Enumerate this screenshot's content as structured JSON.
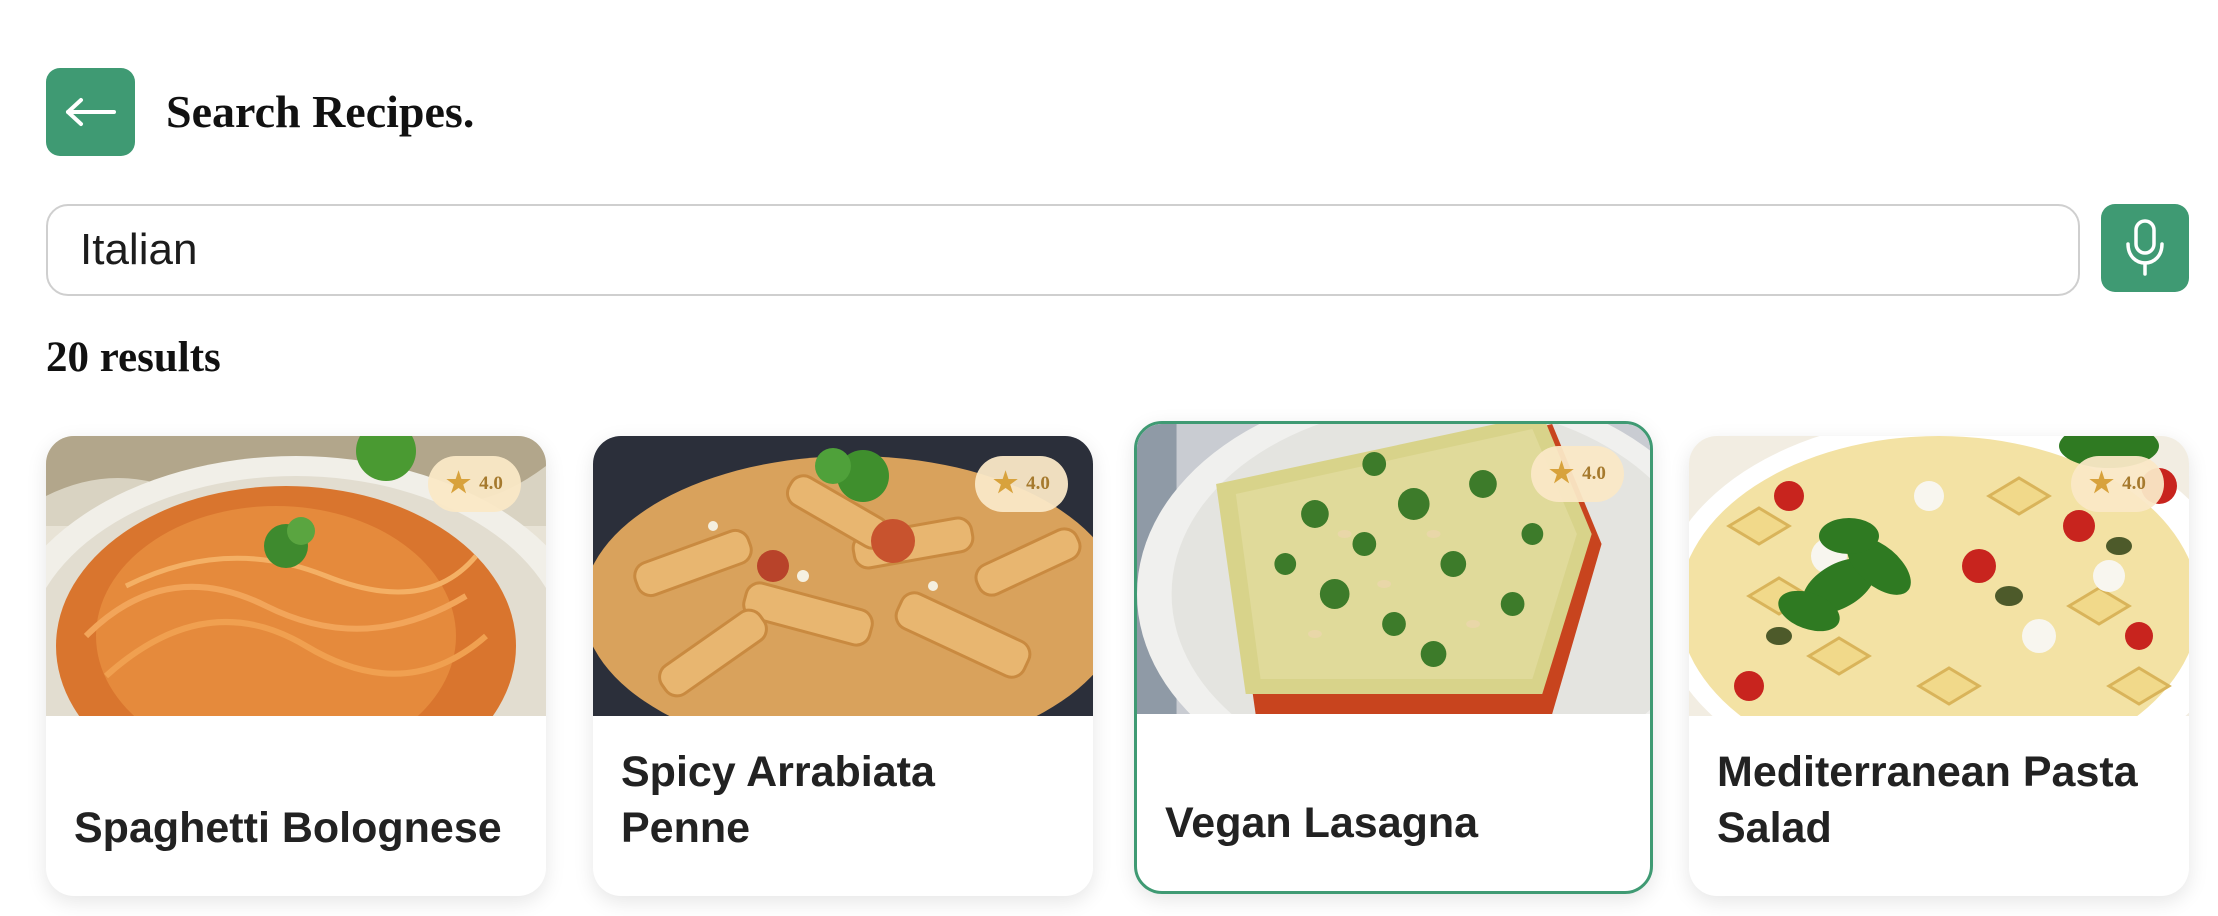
{
  "header": {
    "back_icon": "arrow-left-icon",
    "title": "Search Recipes."
  },
  "search": {
    "value": "Italian",
    "mic_icon": "microphone-icon"
  },
  "results": {
    "count_label": "20 results"
  },
  "cards": [
    {
      "title": "Spaghetti Bolognese",
      "rating": "4.0",
      "rating_icon": "star-icon",
      "selected": false
    },
    {
      "title": "Spicy Arrabiata Penne",
      "rating": "4.0",
      "rating_icon": "star-icon",
      "selected": false
    },
    {
      "title": "Vegan Lasagna",
      "rating": "4.0",
      "rating_icon": "star-icon",
      "selected": true
    },
    {
      "title": "Mediterranean Pasta Salad",
      "rating": "4.0",
      "rating_icon": "star-icon",
      "selected": false
    }
  ],
  "colors": {
    "accent": "#3f9a73",
    "badge_bg": "#fae8c6",
    "star": "#d8a23c"
  }
}
